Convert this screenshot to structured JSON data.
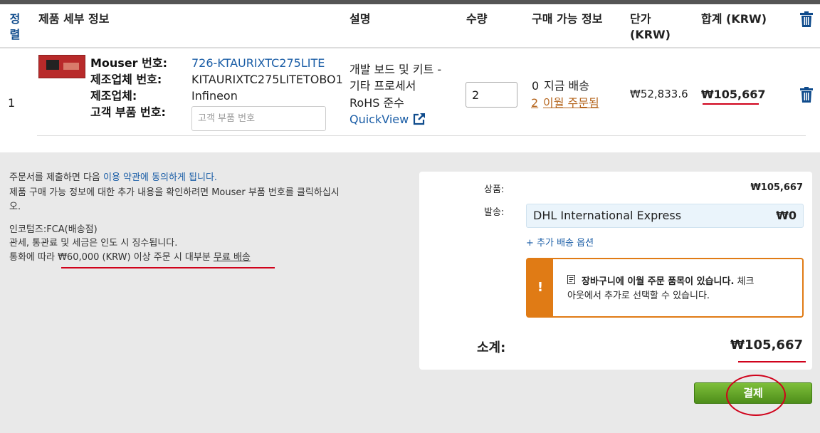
{
  "header": {
    "sort": "정\n렬",
    "details": "제품 세부 정보",
    "description": "설명",
    "quantity": "수량",
    "availability": "구매 가능 정보",
    "unit_price": "단가\n(KRW)",
    "total": "합계 (KRW)"
  },
  "row": {
    "index": "1",
    "mouser_label": "Mouser 번호:",
    "mouser_value": "726-KTAURIXTC275LITE",
    "mfr_part_label": "제조업체 번호:",
    "mfr_part_value": "KITAURIXTC275LITETOBO1",
    "mfr_label": "제조업체:",
    "mfr_value": "Infineon",
    "cust_part_label": "고객 부품 번호:",
    "cust_part_placeholder": "고객 부품 번호",
    "desc_line1": "개발 보드 및 키트 -",
    "desc_line2": "기타 프로세서",
    "rohs": "RoHS 준수",
    "quickview": "QuickView",
    "qty_value": "2",
    "avail_now_count": "0",
    "avail_now_text": "지금 배송",
    "avail_back_count": "2",
    "avail_back_text": "이월 주문됨",
    "unit_price": "₩52,833.6",
    "total": "₩105,667"
  },
  "notice": {
    "terms_pre": "주문서를 제출하면 다음 ",
    "terms_link": "이용 약관에 동의하게 됩니다.",
    "info_line1": "제품 구매 가능 정보에 대한 추가 내용을 확인하려면 Mouser 부품 번호를 클릭하십시",
    "info_line2": "오.",
    "incoterms": "인코텀즈:FCA(배송점)",
    "duties": "관세, 통관료 및 세금은 인도 시 징수됩니다.",
    "currency_pre": "통화에 따라 ",
    "currency_amount": "₩60,000 (KRW) 이상 주문 시 대부분 ",
    "free_shipping": "무료 배송"
  },
  "summary": {
    "items_label": "상품:",
    "items_value": "₩105,667",
    "shipping_label": "발송:",
    "shipping_method": "DHL International Express",
    "shipping_cost": "₩0",
    "more_shipping": "+ 추가 배송 옵션",
    "alert_icon": "!",
    "alert_bold": "장바구니에 이월 주문 품목이 있습니다.",
    "alert_rest1": " 체크",
    "alert_rest2": "아웃에서 추가로 선택할 수 있습니다.",
    "subtotal_label": "소계:",
    "subtotal_value": "₩105,667",
    "checkout_label": "결제"
  },
  "colors": {
    "link": "#1a5da6",
    "alert": "#e07b15",
    "checkout": "#5a9e22",
    "annotation": "#d0021b"
  }
}
